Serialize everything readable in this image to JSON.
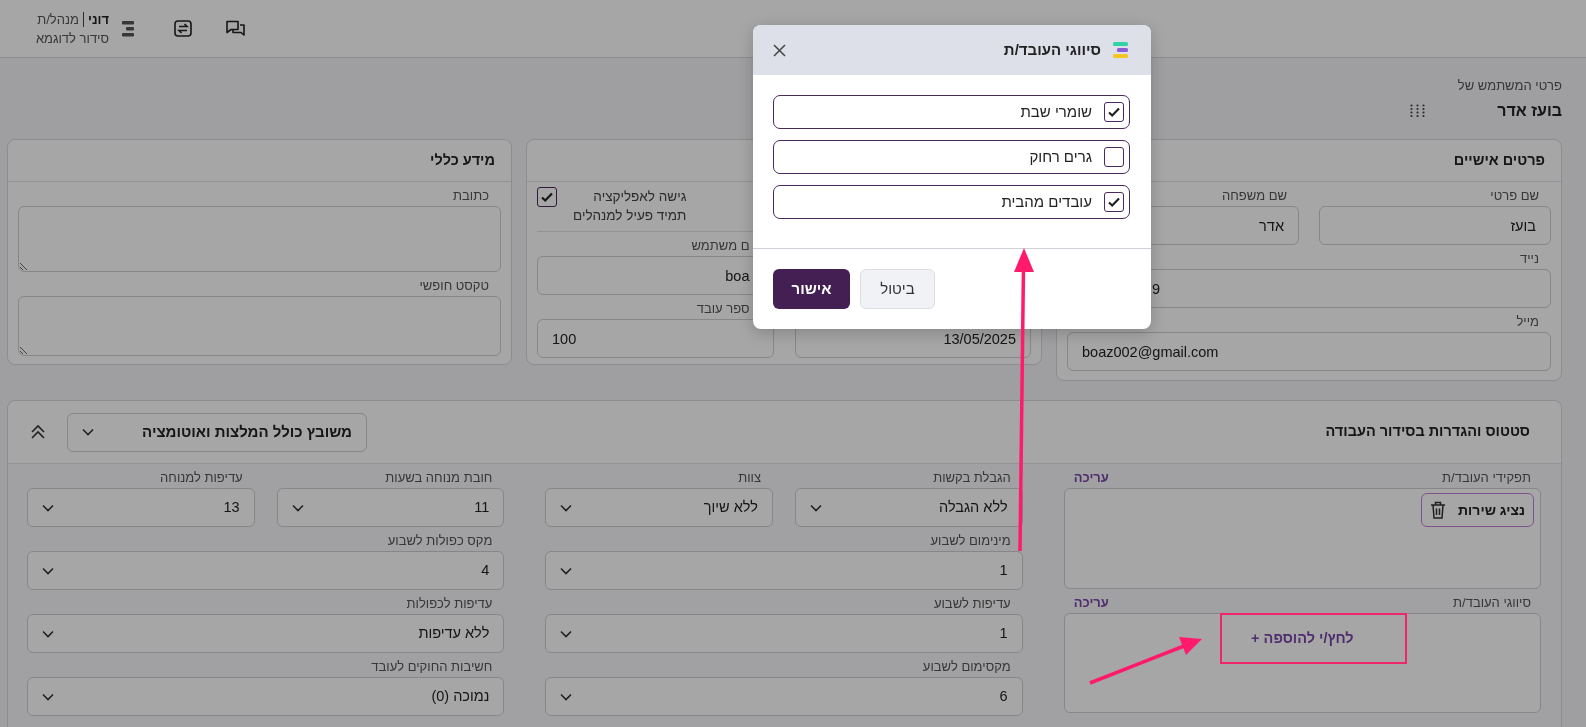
{
  "top_bar": {
    "user_name": "דוני",
    "role": "מנהל/ת",
    "schedule": "סידור לדוגמא"
  },
  "user_header": {
    "caption": "פרטי המשתמש של",
    "name": "בועז אדר"
  },
  "personal_card": {
    "title": "פרטים אישיים",
    "fields": [
      {
        "label": "שם פרטי",
        "value": "בועז",
        "kind": "text"
      },
      {
        "label": "שם משפחה",
        "value": "אדר",
        "kind": "text"
      },
      {
        "label": "נייד",
        "value": "9",
        "kind": "phone"
      },
      {
        "label": "מייל",
        "value": "boaz002@gmail.com",
        "kind": "email"
      }
    ]
  },
  "app_card": {
    "access": {
      "label": "גישה לאפליקציה",
      "note": "תמיד פעיל למנהלים",
      "checked": true
    },
    "fields": [
      {
        "label": "ם משתמש",
        "value": "boa",
        "kind": "text"
      },
      {
        "label": "ספר עובד",
        "value": "100",
        "kind": "number"
      }
    ],
    "date": "13/05/2025"
  },
  "general_card": {
    "title": "מידע כללי",
    "fields": [
      {
        "label": "כתובת"
      },
      {
        "label": "טקסט חופשי"
      }
    ]
  },
  "schedule_card": {
    "title": "סטטוס והגדרות בסידור העבודה",
    "status": "משובץ כולל המלצות ואוטומציה",
    "roles": {
      "label": "תפקידי העובד/ת",
      "edit": "עריכה",
      "tags": [
        {
          "label": "נציג שירות"
        }
      ]
    },
    "classifications": {
      "label": "סיווגי העובד/ת",
      "edit": "עריכה",
      "add": "לחץ/י להוספה +"
    },
    "middle_rows": [
      [
        {
          "label": "הגבלת בקשות",
          "value": "ללא הגבלה"
        },
        {
          "label": "צוות",
          "value": "ללא שיוך"
        }
      ],
      [
        {
          "label": "מינימום לשבוע",
          "value": "1"
        }
      ],
      [
        {
          "label": "עדיפות לשבוע",
          "value": "1"
        }
      ],
      [
        {
          "label": "מקסימום לשבוע",
          "value": "6"
        }
      ]
    ],
    "left_rows": [
      [
        {
          "label": "חובת מנוחה בשעות",
          "value": "11"
        },
        {
          "label": "עדיפות למנוחה",
          "value": "13"
        }
      ],
      [
        {
          "label": "מקס כפולות לשבוע",
          "value": "4"
        }
      ],
      [
        {
          "label": "עדיפות לכפולות",
          "value": "ללא עדיפות"
        }
      ],
      [
        {
          "label": "חשיבות החוקים לעובד",
          "value": "נמוכה (0)"
        }
      ]
    ]
  },
  "dialog": {
    "title": "סיווגי העובד/ת",
    "options": [
      {
        "label": "שומרי שבת",
        "checked": true
      },
      {
        "label": "גרים רחוק",
        "checked": false
      },
      {
        "label": "עובדים מהבית",
        "checked": true
      }
    ],
    "confirm": "אישור",
    "cancel": "ביטול"
  }
}
